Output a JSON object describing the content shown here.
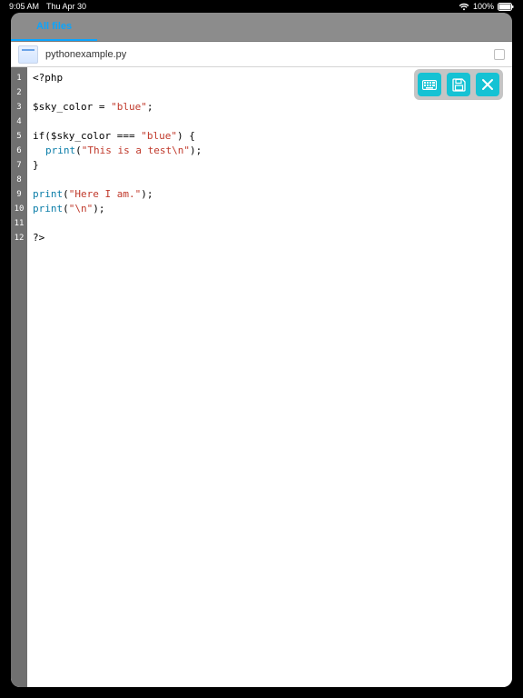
{
  "status_bar": {
    "time": "9:05 AM",
    "date": "Thu Apr 30",
    "battery": "100%"
  },
  "tabs": {
    "active_label": "All files"
  },
  "file": {
    "name": "pythonexample.py"
  },
  "toolbar": {
    "keyboard_icon": "keyboard",
    "save_icon": "save",
    "close_icon": "close"
  },
  "code": {
    "lines": [
      {
        "n": 1,
        "segs": [
          {
            "t": "<?php",
            "c": "kw-php"
          }
        ]
      },
      {
        "n": 2,
        "segs": []
      },
      {
        "n": 3,
        "segs": [
          {
            "t": "$sky_color = ",
            "c": "var"
          },
          {
            "t": "\"blue\"",
            "c": "str"
          },
          {
            "t": ";",
            "c": "var"
          }
        ]
      },
      {
        "n": 4,
        "segs": []
      },
      {
        "n": 5,
        "segs": [
          {
            "t": "if($sky_color === ",
            "c": "var"
          },
          {
            "t": "\"blue\"",
            "c": "str"
          },
          {
            "t": ") {",
            "c": "var"
          }
        ]
      },
      {
        "n": 6,
        "segs": [
          {
            "t": "",
            "c": "ind"
          },
          {
            "t": "print",
            "c": "fn"
          },
          {
            "t": "(",
            "c": "var"
          },
          {
            "t": "\"This is a test\\n\"",
            "c": "str"
          },
          {
            "t": ");",
            "c": "var"
          }
        ]
      },
      {
        "n": 7,
        "segs": [
          {
            "t": "}",
            "c": "var"
          }
        ]
      },
      {
        "n": 8,
        "segs": []
      },
      {
        "n": 9,
        "segs": [
          {
            "t": "print",
            "c": "fn"
          },
          {
            "t": "(",
            "c": "var"
          },
          {
            "t": "\"Here I am.\"",
            "c": "str"
          },
          {
            "t": ");",
            "c": "var"
          }
        ]
      },
      {
        "n": 10,
        "segs": [
          {
            "t": "print",
            "c": "fn"
          },
          {
            "t": "(",
            "c": "var"
          },
          {
            "t": "\"\\n\"",
            "c": "str"
          },
          {
            "t": ");",
            "c": "var"
          }
        ]
      },
      {
        "n": 11,
        "segs": []
      },
      {
        "n": 12,
        "segs": [
          {
            "t": "?>",
            "c": "kw-php"
          }
        ]
      }
    ]
  },
  "colors": {
    "accent": "#15c2d4",
    "tab_blue": "#0aa5ff",
    "string": "#c0392b",
    "function": "#0a7da8"
  }
}
